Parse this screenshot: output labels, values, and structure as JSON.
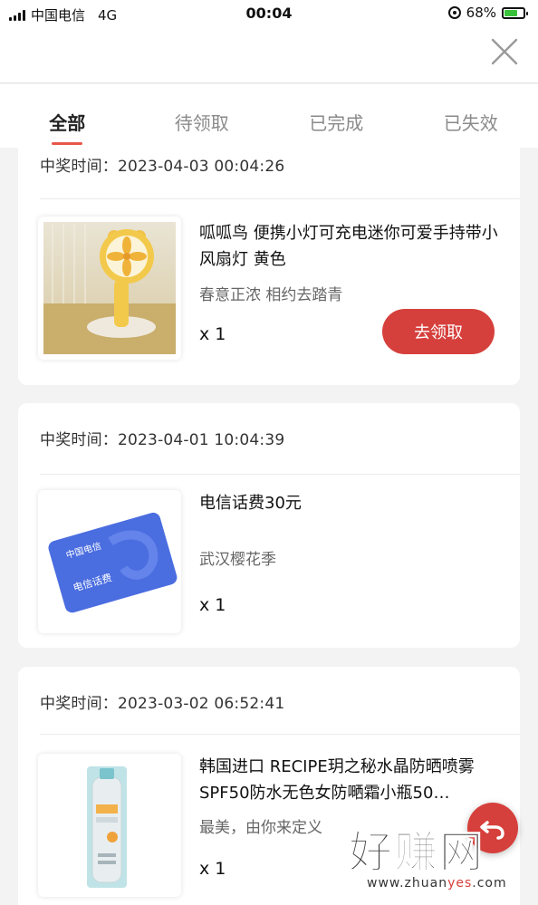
{
  "status_bar": {
    "carrier": "中国电信",
    "network": "4G",
    "time": "00:04",
    "battery": "68%",
    "battery_level": 0.68
  },
  "tabs": [
    {
      "label": "全部",
      "active": true
    },
    {
      "label": "待领取",
      "active": false
    },
    {
      "label": "已完成",
      "active": false
    },
    {
      "label": "已失效",
      "active": false
    }
  ],
  "prizes": [
    {
      "time_label": "中奖时间：2023-04-03 00:04:26",
      "title": "呱呱鸟 便携小灯可充电迷你可爱手持带小风扇灯 黄色",
      "subtitle": "春意正浓 相约去踏青",
      "quantity": "x 1",
      "action": "去领取",
      "image_icon": "fan-lamp-image"
    },
    {
      "time_label": "中奖时间：2023-04-01 10:04:39",
      "title": "电信话费30元",
      "subtitle": "武汉樱花季",
      "quantity": "x 1",
      "card_brand": "中国电信",
      "card_text": "电信话费",
      "image_icon": "phone-credit-card-image"
    },
    {
      "time_label": "中奖时间：2023-03-02 06:52:41",
      "title": "韩国进口 RECIPE玥之秘水晶防晒喷雾SPF50防水无色女防嗮霜小瓶50…",
      "subtitle": "最美，由你来定义",
      "quantity": "x 1",
      "image_icon": "sunscreen-spray-image"
    }
  ],
  "watermark": {
    "text": "好赚网",
    "url_prefix": "www.zhuan",
    "url_highlight": "yes",
    "url_suffix": ".com"
  },
  "colors": {
    "accent": "#d6403c",
    "tab_indicator": "#e8574a",
    "card_blue": "#4a6de0"
  }
}
